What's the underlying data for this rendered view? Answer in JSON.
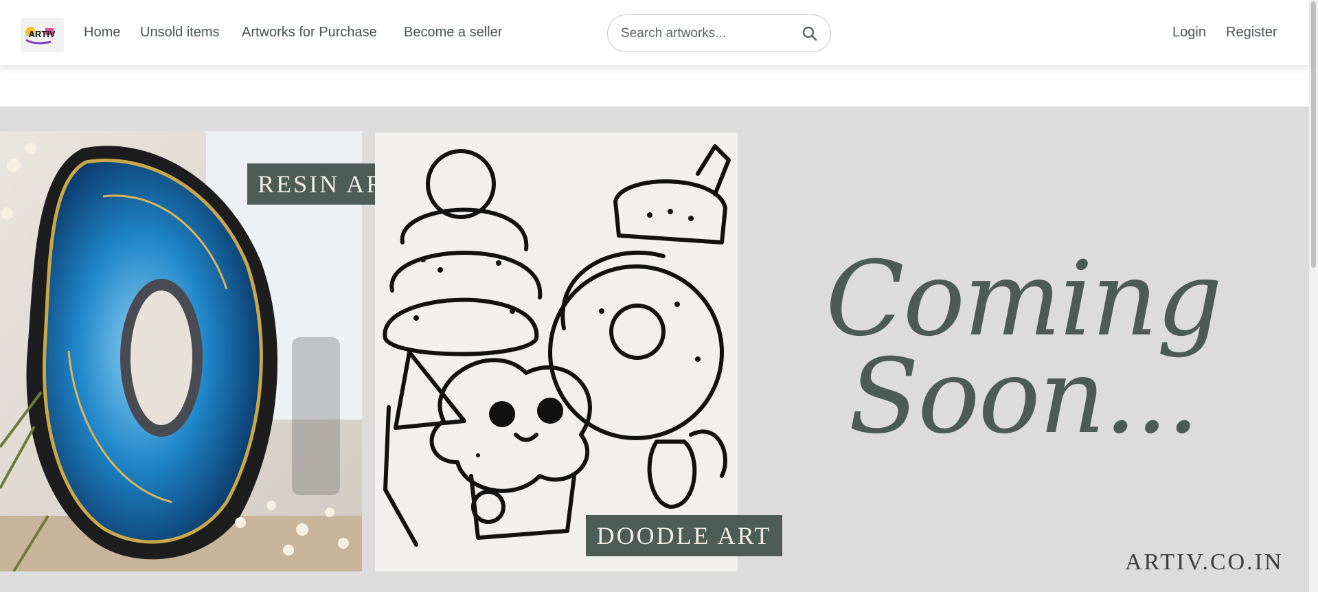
{
  "logo": {
    "text": "ARTIV",
    "alt": "artiv-logo"
  },
  "nav": {
    "links": [
      {
        "label": "Home"
      },
      {
        "label": "Unsold items"
      },
      {
        "label": "Artworks for Purchase"
      },
      {
        "label": "Become a seller"
      }
    ],
    "login_label": "Login",
    "register_label": "Register"
  },
  "search": {
    "placeholder": "Search artworks...",
    "value": "",
    "icon": "search-icon"
  },
  "hero": {
    "resin_label": "RESIN ART",
    "doodle_label": "DOODLE ART",
    "coming_line1": "Coming",
    "coming_line2": "Soon...",
    "site_url": "ARTIV.CO.IN"
  },
  "colors": {
    "accent_box": "#4d5c57",
    "hero_bg": "#dcdcdc",
    "nav_text": "#4a5056"
  }
}
